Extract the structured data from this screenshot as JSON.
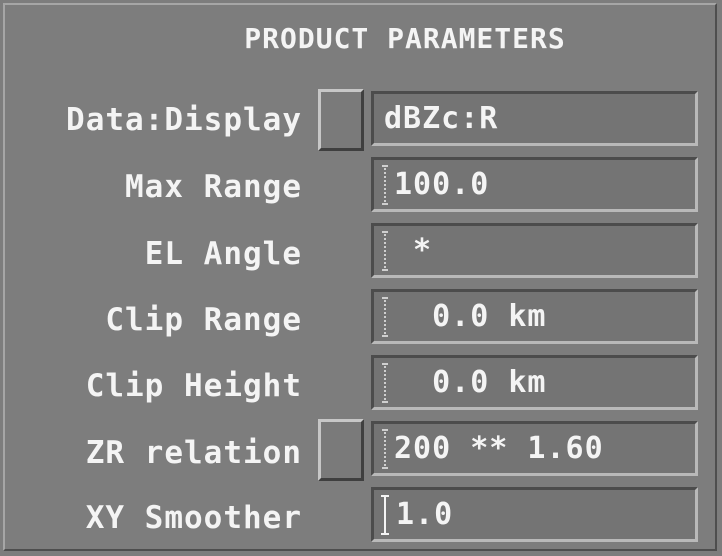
{
  "panel": {
    "title": "PRODUCT PARAMETERS"
  },
  "rows": [
    {
      "label": "Data:Display",
      "value": "dBZc:R"
    },
    {
      "label": "Max Range",
      "value": "100.0"
    },
    {
      "label": "EL Angle",
      "value": " *"
    },
    {
      "label": "Clip Range",
      "value": "  0.0 km"
    },
    {
      "label": "Clip Height",
      "value": "  0.0 km"
    },
    {
      "label": "ZR relation",
      "value": "200 ** 1.60"
    },
    {
      "label": "XY Smoother",
      "value": "1.0"
    }
  ]
}
